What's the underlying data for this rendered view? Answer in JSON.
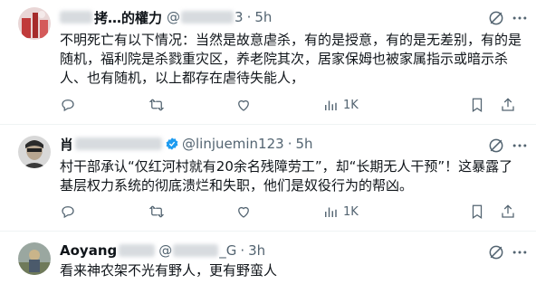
{
  "tweets": [
    {
      "name": "拷…的權力",
      "handle": "@",
      "handle_tail": "3",
      "dot": "·",
      "time": "5h",
      "text": "不明死亡有以下情况：当然是故意虐杀，有的是授意，有的是无差别，有的是随机，福利院是杀戮重灾区，养老院其次，居家保姆也被家属指示或暗示杀人、也有随机，以上都存在虐待失能人，",
      "views": "1K"
    },
    {
      "name": "肖",
      "handle": "@linjuemin123",
      "dot": "·",
      "time": "5h",
      "text": "村干部承认“仅红河村就有20余名残障劳工”，却“长期无人干预”！这暴露了基层权力系统的彻底溃烂和失职，他们是奴役行为的帮凶。",
      "views": "1K"
    },
    {
      "name": "Aoyang",
      "handle": "@",
      "handle_tail": "_G",
      "dot": "·",
      "time": "3h",
      "text": "看来神农架不光有野人，更有野蛮人"
    }
  ],
  "icons": {
    "mute": "mute-icon",
    "more": "more-icon",
    "reply": "reply-icon",
    "retweet": "retweet-icon",
    "like": "like-icon",
    "views": "views-icon",
    "bookmark": "bookmark-icon",
    "share": "share-icon",
    "verified": "verified-badge-icon"
  },
  "colors": {
    "text": "#0f1419",
    "secondary": "#536471",
    "verified": "#1d9bf0",
    "divider": "#eff3f4"
  }
}
